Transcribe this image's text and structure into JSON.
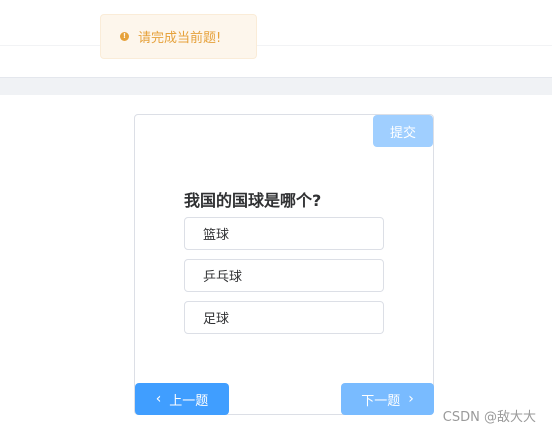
{
  "toast": {
    "icon": "warning-circle-icon",
    "message": "请完成当前题!"
  },
  "quiz": {
    "submit_label": "提交",
    "question": "我国的国球是哪个?",
    "options": [
      "篮球",
      "乒乓球",
      "足球"
    ],
    "prev_label": "上一题",
    "next_label": "下一题"
  },
  "watermark": "CSDN @敌大大",
  "colors": {
    "primary": "#409eff",
    "primary_light": "#79bbff",
    "primary_disabled": "#a0cfff",
    "warning": "#e6a23c",
    "warning_bg": "#fdf6ec"
  }
}
